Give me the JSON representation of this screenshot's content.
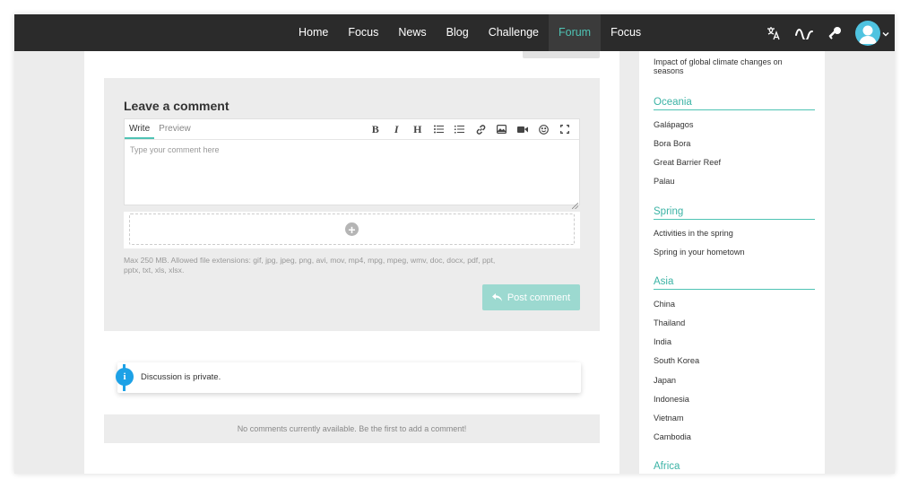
{
  "nav": {
    "items": [
      {
        "label": "Home"
      },
      {
        "label": "Focus"
      },
      {
        "label": "News"
      },
      {
        "label": "Blog"
      },
      {
        "label": "Challenge"
      },
      {
        "label": "Forum",
        "active": true
      },
      {
        "label": "Focus"
      }
    ],
    "icons": [
      "translate-icon",
      "activity-icon",
      "key-icon",
      "avatar",
      "chevron-down-icon"
    ],
    "accent": "#4fc3b4"
  },
  "comment": {
    "title": "Leave a comment",
    "tab_write": "Write",
    "tab_preview": "Preview",
    "placeholder": "Type your comment here",
    "upload_hint": "Max 250 MB. Allowed file extensions: gif, jpg, jpeg, png, avi, mov, mp4, mpg, mpeg, wmv, doc, docx, pdf, ppt, pptx, txt, xls, xlsx.",
    "post_label": "Post comment",
    "toolbar": [
      "bold-icon",
      "italic-icon",
      "heading-icon",
      "bullet-list-icon",
      "numbered-list-icon",
      "link-icon",
      "image-icon",
      "video-icon",
      "emoji-icon",
      "fullscreen-icon"
    ]
  },
  "notice": {
    "text": "Discussion is private.",
    "color": "#1da1e6"
  },
  "empty": {
    "text": "No comments currently available. Be the first to add a comment!"
  },
  "sidebar": {
    "top_item": "Impact of global climate changes on seasons",
    "sections": [
      {
        "title": "Oceania",
        "items": [
          "Galápagos",
          "Bora Bora",
          "Great Barrier Reef",
          "Palau"
        ]
      },
      {
        "title": "Spring",
        "items": [
          "Activities in the spring",
          "Spring in your hometown"
        ]
      },
      {
        "title": "Asia",
        "items": [
          "China",
          "Thailand",
          "India",
          "South Korea",
          "Japan",
          "Indonesia",
          "Vietnam",
          "Cambodia"
        ]
      },
      {
        "title": "Africa",
        "items": []
      }
    ]
  }
}
